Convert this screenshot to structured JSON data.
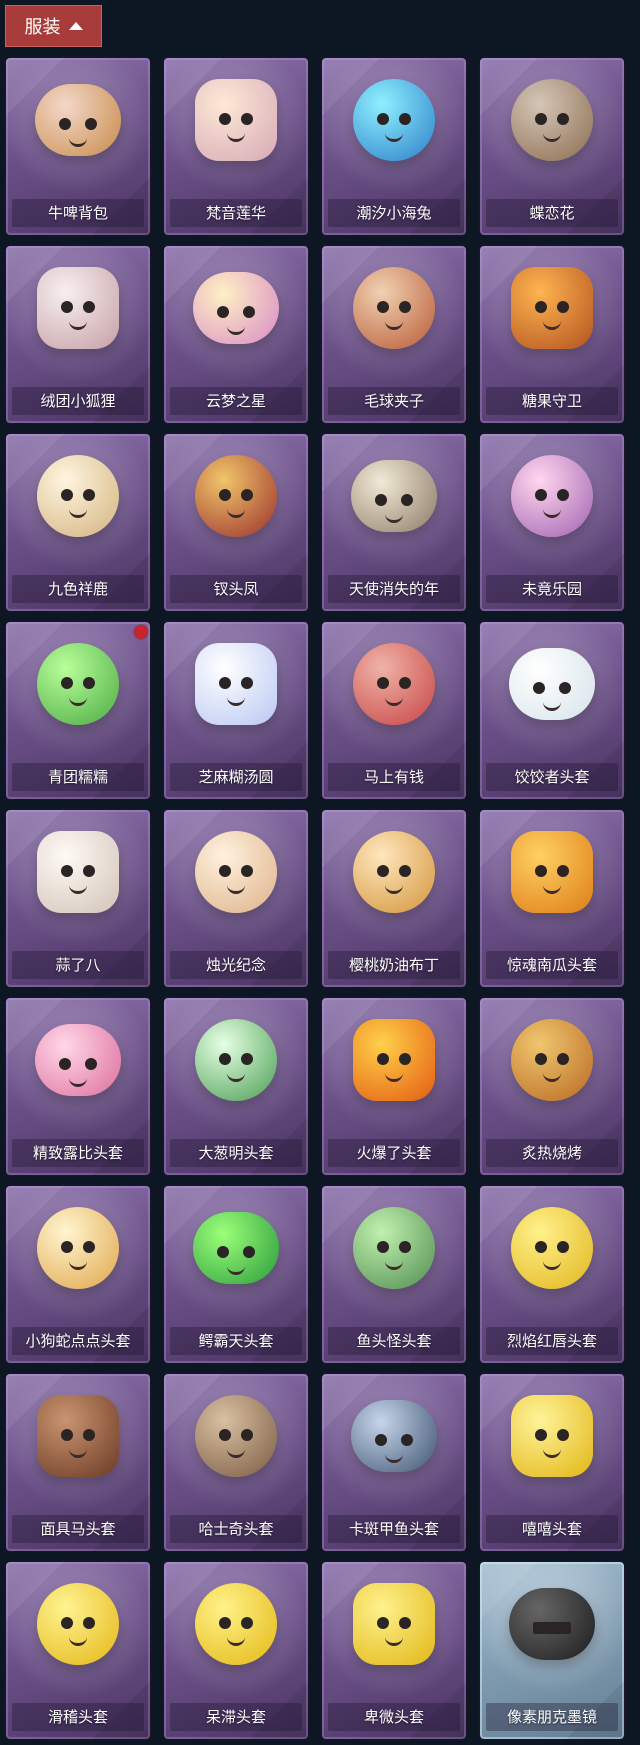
{
  "header": {
    "title": "服装"
  },
  "items": [
    {
      "label": "牛啤背包",
      "icon": "backpack-icon",
      "c1": "#c78b49",
      "c2": "#f4d7c9"
    },
    {
      "label": "梵音莲华",
      "icon": "fairy-icon",
      "c1": "#d7a9b6",
      "c2": "#fde9d6"
    },
    {
      "label": "潮汐小海兔",
      "icon": "sea-rabbit-icon",
      "c1": "#2b7ec9",
      "c2": "#8ff0ff"
    },
    {
      "label": "蝶恋花",
      "icon": "flower-wreath-icon",
      "c1": "#8a6c4d",
      "c2": "#d5c6b8"
    },
    {
      "label": "绒团小狐狸",
      "icon": "fox-icon",
      "c1": "#c5a0a5",
      "c2": "#f8efef"
    },
    {
      "label": "云梦之星",
      "icon": "unicorn-icon",
      "c1": "#d98bc6",
      "c2": "#fff0c4"
    },
    {
      "label": "毛球夹子",
      "icon": "raccoon-icon",
      "c1": "#b95a34",
      "c2": "#f0d1b2"
    },
    {
      "label": "糖果守卫",
      "icon": "pumpkin-guard-icon",
      "c1": "#b2531f",
      "c2": "#ffb451"
    },
    {
      "label": "九色祥鹿",
      "icon": "deer-icon",
      "c1": "#d2b27d",
      "c2": "#fff5df"
    },
    {
      "label": "钗头凤",
      "icon": "phoenix-crown-icon",
      "c1": "#9a2f2b",
      "c2": "#f1c56a"
    },
    {
      "label": "天使消失的年",
      "icon": "angel-icon",
      "c1": "#8c7b66",
      "c2": "#f1e9d6"
    },
    {
      "label": "未竟乐园",
      "icon": "bunny-girl-icon",
      "c1": "#a062b0",
      "c2": "#ffd6ef"
    },
    {
      "label": "青团糯糯",
      "icon": "green-bun-icon",
      "c1": "#4caa42",
      "c2": "#b8ff9a",
      "badge": true
    },
    {
      "label": "芝麻糊汤圆",
      "icon": "tangyuan-icon",
      "c1": "#b9c8f3",
      "c2": "#ffffff"
    },
    {
      "label": "马上有钱",
      "icon": "horse-icon",
      "c1": "#c74343",
      "c2": "#f0b3a7"
    },
    {
      "label": "饺饺者头套",
      "icon": "dumpling-icon",
      "c1": "#d5e3ea",
      "c2": "#ffffff"
    },
    {
      "label": "蒜了八",
      "icon": "garlic-icon",
      "c1": "#d1c3b7",
      "c2": "#fffaf5"
    },
    {
      "label": "烛光纪念",
      "icon": "candle-icon",
      "c1": "#ddb28a",
      "c2": "#fff1dd"
    },
    {
      "label": "樱桃奶油布丁",
      "icon": "pudding-icon",
      "c1": "#d29439",
      "c2": "#ffe6bd"
    },
    {
      "label": "惊魂南瓜头套",
      "icon": "pumpkin-icon",
      "c1": "#de7d17",
      "c2": "#ffd062"
    },
    {
      "label": "精致露比头套",
      "icon": "pink-bird-icon",
      "c1": "#de6d9c",
      "c2": "#ffd7e8"
    },
    {
      "label": "大葱明头套",
      "icon": "scallion-icon",
      "c1": "#4a9d51",
      "c2": "#e5ffe4"
    },
    {
      "label": "火爆了头套",
      "icon": "fire-icon",
      "c1": "#e45b11",
      "c2": "#ffd14a"
    },
    {
      "label": "炙热烧烤",
      "icon": "bbq-icon",
      "c1": "#b86922",
      "c2": "#f0c66e"
    },
    {
      "label": "小狗蛇点点头套",
      "icon": "snake-icon",
      "c1": "#e0a54a",
      "c2": "#fff5cf"
    },
    {
      "label": "鳄霸天头套",
      "icon": "crocodile-icon",
      "c1": "#2a9b3a",
      "c2": "#9bff7a"
    },
    {
      "label": "鱼头怪头套",
      "icon": "fish-monster-icon",
      "c1": "#4f8d4f",
      "c2": "#c1f0b0"
    },
    {
      "label": "烈焰红唇头套",
      "icon": "pikachu-icon",
      "c1": "#e1b51d",
      "c2": "#fff18b"
    },
    {
      "label": "面具马头套",
      "icon": "horse-mask-icon",
      "c1": "#6b3a24",
      "c2": "#c99470"
    },
    {
      "label": "哈士奇头套",
      "icon": "husky-icon",
      "c1": "#7a5b42",
      "c2": "#d9c0a2"
    },
    {
      "label": "卡斑甲鱼头套",
      "icon": "turtle-icon",
      "c1": "#40536f",
      "c2": "#c5d6eb"
    },
    {
      "label": "嘻嘻头套",
      "icon": "grin-icon",
      "c1": "#e2b614",
      "c2": "#fff39a"
    },
    {
      "label": "滑稽头套",
      "icon": "funny-face-icon",
      "c1": "#e4b614",
      "c2": "#fff391"
    },
    {
      "label": "呆滞头套",
      "icon": "dazed-face-icon",
      "c1": "#e3b711",
      "c2": "#fff28a"
    },
    {
      "label": "卑微头套",
      "icon": "humble-face-icon",
      "c1": "#e1b715",
      "c2": "#fff18d"
    },
    {
      "label": "像素朋克墨镜",
      "icon": "pixel-glasses-icon",
      "c1": "#1c1c1c",
      "c2": "#666666",
      "special": true
    }
  ]
}
